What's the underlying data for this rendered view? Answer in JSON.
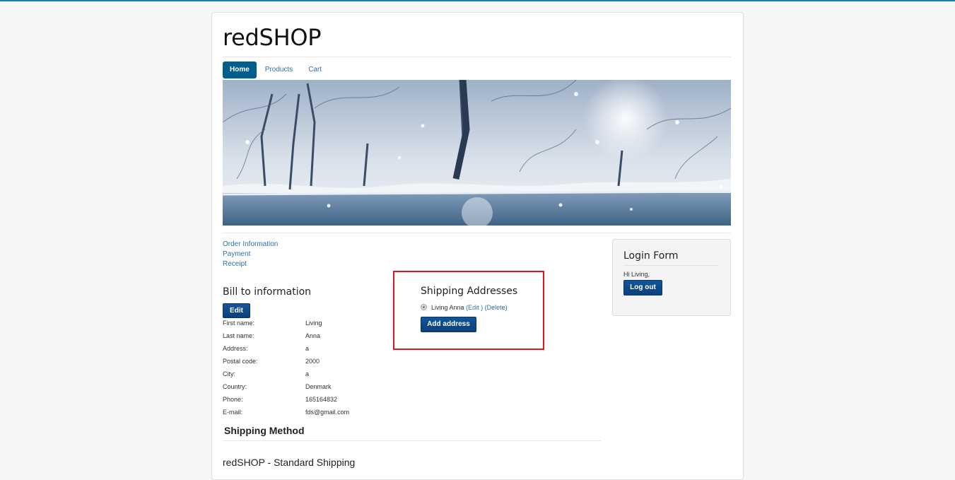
{
  "site": {
    "brand": "redSHOP"
  },
  "nav": {
    "items": [
      {
        "label": "Home"
      },
      {
        "label": "Products"
      },
      {
        "label": "Cart"
      }
    ]
  },
  "steps": {
    "order_info": "Order Information",
    "payment": "Payment",
    "receipt": "Receipt"
  },
  "bill": {
    "title": "Bill to information",
    "edit_label": "Edit",
    "rows": [
      {
        "label": "First name:",
        "value": "Living"
      },
      {
        "label": "Last name:",
        "value": "Anna"
      },
      {
        "label": "Address:",
        "value": "a"
      },
      {
        "label": "Postal code:",
        "value": "2000"
      },
      {
        "label": "City:",
        "value": "a"
      },
      {
        "label": "Country:",
        "value": "Denmark"
      },
      {
        "label": "Phone:",
        "value": "165164832"
      },
      {
        "label": "E-mail:",
        "value": "fds@gmail.com"
      }
    ]
  },
  "shipping": {
    "title": "Shipping Addresses",
    "address_name": "Living Anna",
    "edit_link": "(Edit )",
    "delete_link": "(Delete)",
    "add_label": "Add address"
  },
  "method": {
    "title": "Shipping Method",
    "option_label": "redSHOP - Standard Shipping"
  },
  "login": {
    "title": "Login Form",
    "greeting": "Hi Living,",
    "logout_label": "Log out"
  },
  "colors": {
    "accent": "#005e8d",
    "button": "#0c3f7a",
    "highlight_box": "#e0161f",
    "link": "#2f6ea7"
  }
}
